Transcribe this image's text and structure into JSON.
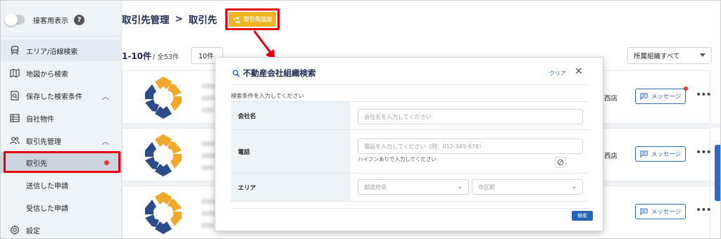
{
  "sidebar": {
    "customer_view_label": "接客用表示",
    "help_icon_char": "?",
    "items": [
      {
        "label": "エリア/沿線検索"
      },
      {
        "label": "地図から検索"
      },
      {
        "label": "保存した検索条件"
      },
      {
        "label": "自社物件"
      },
      {
        "label": "取引先管理"
      },
      {
        "label": "取引先"
      },
      {
        "label": "送信した申請"
      },
      {
        "label": "受信した申請"
      },
      {
        "label": "設定"
      }
    ]
  },
  "header": {
    "breadcrumb_parent": "取引先管理",
    "breadcrumb_sep": ">",
    "breadcrumb_current": "取引先",
    "add_button_label": "取引先追加"
  },
  "list": {
    "range": "1-10件",
    "total": "/ 全53件",
    "per_page": "10件",
    "org_filter": "所属組織すべて",
    "rows": [
      {
        "branch": "西店",
        "message_label": "メッセージ",
        "unread": true
      },
      {
        "branch": "西店",
        "message_label": "メッセージ",
        "unread": false
      },
      {
        "branch": "",
        "message_label": "メッセージ",
        "unread": false
      }
    ],
    "more_icon": "•••"
  },
  "modal": {
    "title": "不動産会社組織検索",
    "clear_label": "クリア",
    "close_char": "✕",
    "subtitle": "検索条件を入力してください",
    "fields": {
      "company_label": "会社名",
      "company_placeholder": "会社名を入力してください",
      "phone_label": "電話",
      "phone_placeholder": "電話を入力してください（例：012-345-678）",
      "phone_hint": "ハイフンありで入力してください",
      "area_label": "エリア",
      "prefecture_placeholder": "都道府県",
      "city_placeholder": "市区郡"
    },
    "search_button_label": "検索"
  },
  "colors": {
    "accent": "#2d6bc2",
    "add_button": "#f0b41c",
    "highlight": "#e60012",
    "title": "#1c2a55"
  }
}
